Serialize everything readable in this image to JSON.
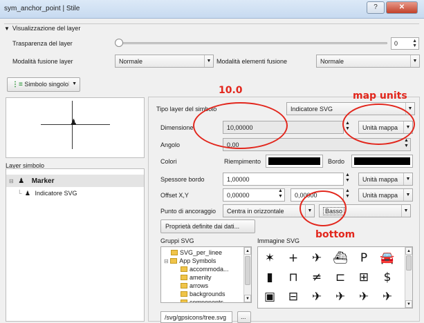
{
  "window": {
    "title": "sym_anchor_point | Stile",
    "help_glyph": "?",
    "close_glyph": "✕"
  },
  "layer_render": {
    "header": "Visualizzazione del layer",
    "transparency_label": "Trasparenza del layer",
    "transparency_value": "0",
    "blend_label": "Modalità fusione layer",
    "blend_value": "Normale",
    "feature_blend_label": "Modalità elementi fusione",
    "feature_blend_value": "Normale"
  },
  "renderer": {
    "label": "Simbolo singolo"
  },
  "symbol_tree": {
    "title": "Layer simbolo",
    "items": [
      {
        "label": "Marker"
      },
      {
        "label": "Indicatore SVG"
      }
    ]
  },
  "symbol_layer": {
    "type_label": "Tipo layer del simbolo",
    "type_value": "Indicatore SVG",
    "size_label": "Dimensione",
    "size_value": "10,00000",
    "size_unit": "Unità mappa",
    "angle_label": "Angolo",
    "angle_value": "0,00",
    "colors_label": "Colori",
    "fill_label": "Riempimento",
    "border_label": "Bordo",
    "fill_color": "#000000",
    "border_color": "#000000",
    "border_width_label": "Spessore bordo",
    "border_width_value": "1,00000",
    "border_width_unit": "Unità mappa",
    "offset_label": "Offset X,Y",
    "offset_x": "0,00000",
    "offset_y": "0,00000",
    "offset_unit": "Unità mappa",
    "anchor_label": "Punto di ancoraggio",
    "anchor_h": "Centra in orizzontale",
    "anchor_v": "Basso",
    "data_defined_button": "Proprietà definite dai dati...",
    "svg_groups_label": "Gruppi SVG",
    "svg_images_label": "Immagine SVG",
    "svg_groups": [
      "SVG_per_linee",
      "App Symbols",
      "accommoda...",
      "amenity",
      "arrows",
      "backgrounds",
      "components"
    ],
    "svg_path": "/svg/gpsicons/tree.svg",
    "browse_button": "..."
  },
  "svg_icons": [
    {
      "name": "compass-star-icon",
      "glyph": "✶"
    },
    {
      "name": "cross-icon",
      "glyph": "+"
    },
    {
      "name": "airplane-icon",
      "glyph": "✈"
    },
    {
      "name": "ship-icon",
      "glyph": "⛴"
    },
    {
      "name": "parking-icon",
      "glyph": "P"
    },
    {
      "name": "car-icon",
      "glyph": "🚘"
    },
    {
      "name": "bollard-icon",
      "glyph": "▮"
    },
    {
      "name": "gate-icon",
      "glyph": "⊓"
    },
    {
      "name": "not-equal-icon",
      "glyph": "≠"
    },
    {
      "name": "barrier-icon",
      "glyph": "⊏"
    },
    {
      "name": "fence-icon",
      "glyph": "⊞"
    },
    {
      "name": "money-icon",
      "glyph": "$"
    },
    {
      "name": "bus-icon",
      "glyph": "▣"
    },
    {
      "name": "tram-icon",
      "glyph": "⊟"
    },
    {
      "name": "plane-outline-icon",
      "glyph": "✈"
    },
    {
      "name": "plane-icon",
      "glyph": "✈"
    },
    {
      "name": "plane-small-icon",
      "glyph": "✈"
    },
    {
      "name": "plane-large-icon",
      "glyph": "✈"
    }
  ],
  "annotations": {
    "size_note": "10.0",
    "units_note": "map units",
    "anchor_note": "bottom",
    "color": "#e2261c"
  }
}
